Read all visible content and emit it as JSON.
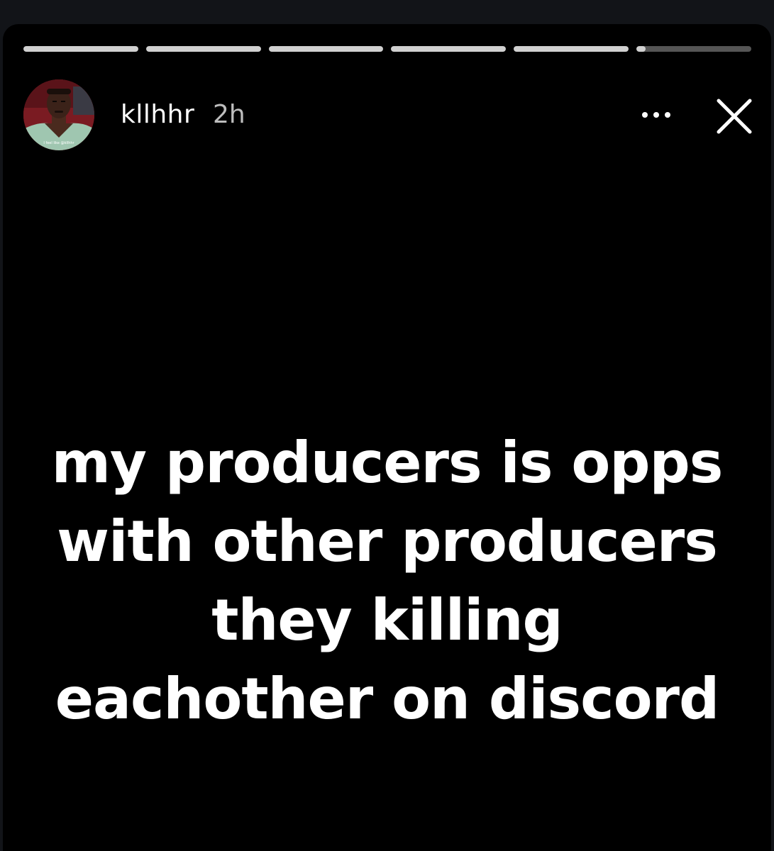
{
  "story": {
    "progress_segments": [
      {
        "fill": 1.0
      },
      {
        "fill": 1.0
      },
      {
        "fill": 1.0
      },
      {
        "fill": 1.0
      },
      {
        "fill": 1.0
      },
      {
        "fill": 0.08
      }
    ],
    "header": {
      "avatar_caption": "I feel like @kllhhr",
      "username": "kllhhr",
      "timestamp": "2h",
      "more_icon": "more-dots-icon",
      "close_icon": "close-icon"
    },
    "caption_lines": [
      "my producers is opps",
      "with other producers",
      "they killing",
      "eachother on discord"
    ]
  },
  "colors": {
    "background": "#000000",
    "text": "#ffffff",
    "timestamp": "#bdbdbd",
    "progress_track": "#555555",
    "progress_fill": "#d0d0d0"
  }
}
